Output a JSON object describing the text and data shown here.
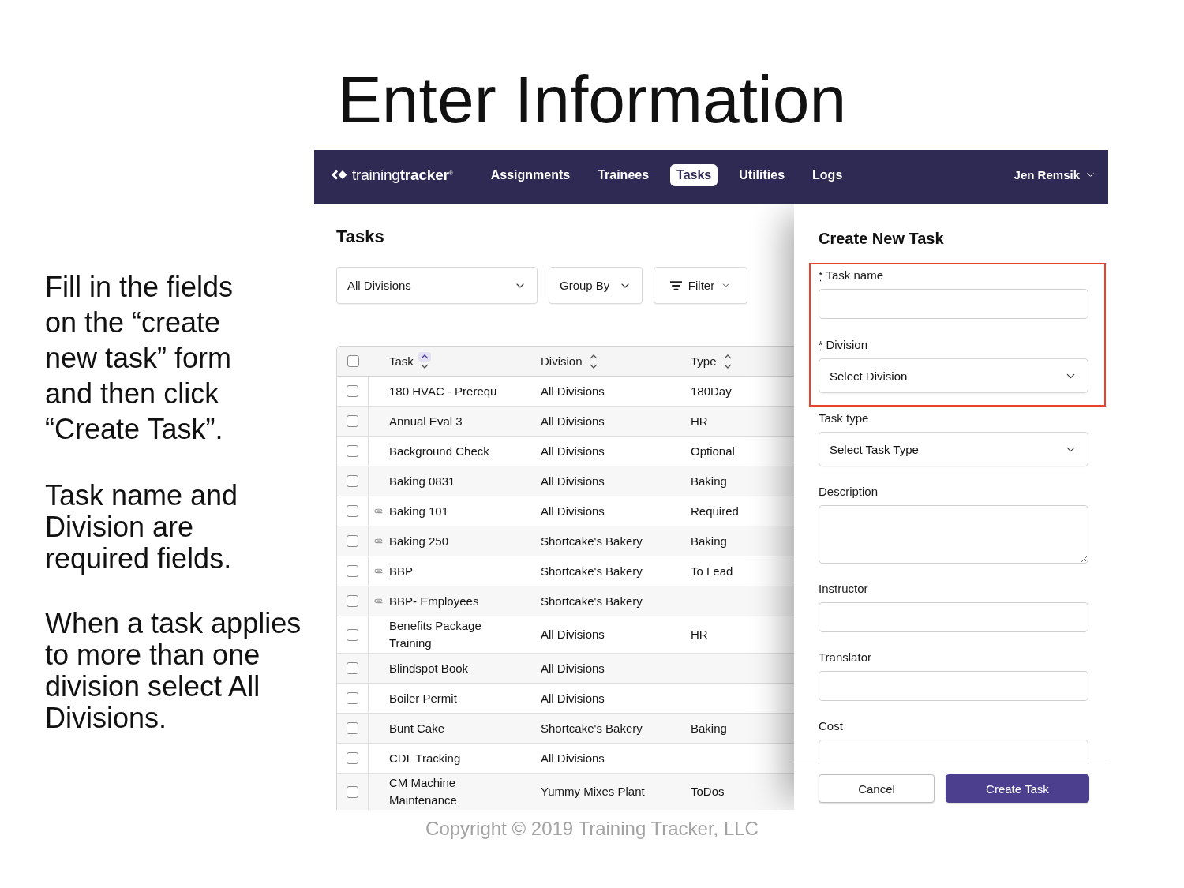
{
  "slide_title": "Enter Information",
  "notes": [
    "Fill in the fields\non the “create\nnew task” form\nand then click\n“Create Task”.",
    "Task name and\nDivision are\nrequired fields.",
    "When a task applies\nto more than one\ndivision select All\nDivisions."
  ],
  "navbar": {
    "logo": "training**tracker**$^{®}$",
    "items": [
      {
        "label": "Assignments",
        "selected": false
      },
      {
        "label": "Trainees",
        "selected": false
      },
      {
        "label": "Tasks",
        "selected": true
      },
      {
        "label": "Utilities",
        "selected": false
      },
      {
        "label": "Logs",
        "selected": false
      }
    ],
    "user": "Jen Remsik"
  },
  "tasks_pane": {
    "title": "Tasks",
    "controls": [
      {
        "kind": "select",
        "label": "All Divisions"
      },
      {
        "kind": "select",
        "label": "Group By"
      },
      {
        "kind": "filter",
        "label": "Filter"
      }
    ]
  },
  "table": {
    "select_all": {
      "checked": false
    },
    "columns": [
      {
        "label": "Task",
        "sorted": true
      },
      {
        "label": "Division",
        "sorted": false
      },
      {
        "label": "Type",
        "sorted": false
      }
    ],
    "rows": [
      {
        "task": "180 HVAC - Prerequ",
        "division": "All Divisions",
        "type": "180Day",
        "attachment": false,
        "checked": false
      },
      {
        "task": "Annual Eval 3",
        "division": "All Divisions",
        "type": "HR",
        "attachment": false,
        "checked": false
      },
      {
        "task": "Background Check",
        "division": "All Divisions",
        "type": "Optional",
        "attachment": false,
        "checked": false
      },
      {
        "task": "Baking 0831",
        "division": "All Divisions",
        "type": "Baking",
        "attachment": false,
        "checked": false
      },
      {
        "task": "Baking 101",
        "division": "All Divisions",
        "type": "Required",
        "attachment": true,
        "checked": false
      },
      {
        "task": "Baking 250",
        "division": "Shortcake's Bakery",
        "type": "Baking",
        "attachment": true,
        "checked": false
      },
      {
        "task": "BBP",
        "division": "Shortcake's Bakery",
        "type": "To Lead",
        "attachment": true,
        "checked": false
      },
      {
        "task": "BBP- Employees",
        "division": "Shortcake's Bakery",
        "attachment": true,
        "checked": false
      },
      {
        "task": "Benefits Package Training",
        "division": "All Divisions",
        "type": "HR",
        "attachment": false,
        "checked": false
      },
      {
        "task": "Blindspot Book",
        "division": "All Divisions",
        "attachment": false,
        "checked": false
      },
      {
        "task": "Boiler Permit",
        "division": "All Divisions",
        "attachment": false,
        "checked": false
      },
      {
        "task": "Bunt Cake",
        "division": "Shortcake's Bakery",
        "type": "Baking",
        "attachment": false,
        "checked": false
      },
      {
        "task": "CDL Tracking",
        "division": "All Divisions",
        "attachment": false,
        "checked": false
      },
      {
        "task": "CM Machine Maintenance",
        "division": "Yummy Mixes Plant",
        "type": "ToDos",
        "attachment": false,
        "checked": false
      }
    ]
  },
  "create_task": {
    "title": "Create New Task",
    "fields": [
      {
        "kind": "text",
        "label": "Task name",
        "mark": "*",
        "highlighted": true
      },
      {
        "kind": "select",
        "label": "Division",
        "mark": "*",
        "value": "Select Division",
        "highlighted": true
      },
      {
        "kind": "select",
        "label": "Task type",
        "value": "Select Task Type",
        "highlighted": false
      },
      {
        "kind": "textarea",
        "label": "Description",
        "highlighted": false
      },
      {
        "kind": "text",
        "label": "Instructor",
        "highlighted": false
      },
      {
        "kind": "text",
        "label": "Translator",
        "highlighted": false
      },
      {
        "kind": "text",
        "label": "Cost",
        "highlighted": false
      }
    ],
    "buttons": [
      {
        "label": "Cancel",
        "kind": "secondary"
      },
      {
        "label": "Create Task",
        "kind": "primary"
      }
    ]
  },
  "copyright": "Copyright © 2019 Training Tracker, LLC"
}
